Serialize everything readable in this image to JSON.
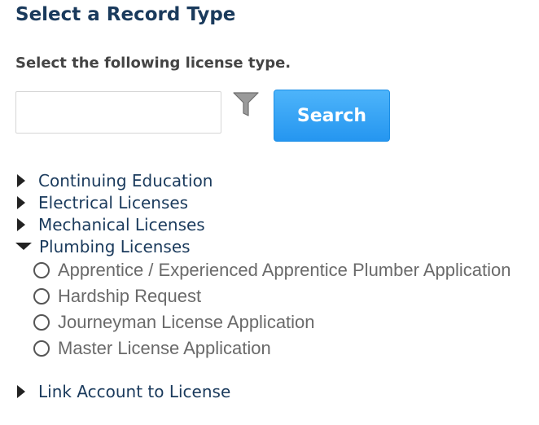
{
  "page": {
    "title": "Select a Record Type",
    "instruction": "Select the following license type."
  },
  "search": {
    "value": "",
    "placeholder": "",
    "button_label": "Search",
    "filter_icon": "filter-funnel-icon"
  },
  "tree": {
    "categories": [
      {
        "label": "Continuing Education",
        "expanded": false,
        "icon": "caret-right-icon"
      },
      {
        "label": "Electrical Licenses",
        "expanded": false,
        "icon": "caret-right-icon"
      },
      {
        "label": "Mechanical Licenses",
        "expanded": false,
        "icon": "caret-right-icon"
      },
      {
        "label": "Plumbing Licenses",
        "expanded": true,
        "icon": "caret-down-icon",
        "options": [
          {
            "label": "Apprentice / Experienced Apprentice Plumber Application",
            "selected": false
          },
          {
            "label": "Hardship Request",
            "selected": false
          },
          {
            "label": "Journeyman License Application",
            "selected": false
          },
          {
            "label": "Master License Application",
            "selected": false
          }
        ]
      },
      {
        "label": "Link Account to License",
        "expanded": false,
        "icon": "caret-right-icon"
      }
    ]
  },
  "colors": {
    "heading": "#1a3a5c",
    "instruction": "#444444",
    "button_bg": "#2596f0",
    "button_text": "#ffffff",
    "option_text": "#6a6a6a"
  }
}
